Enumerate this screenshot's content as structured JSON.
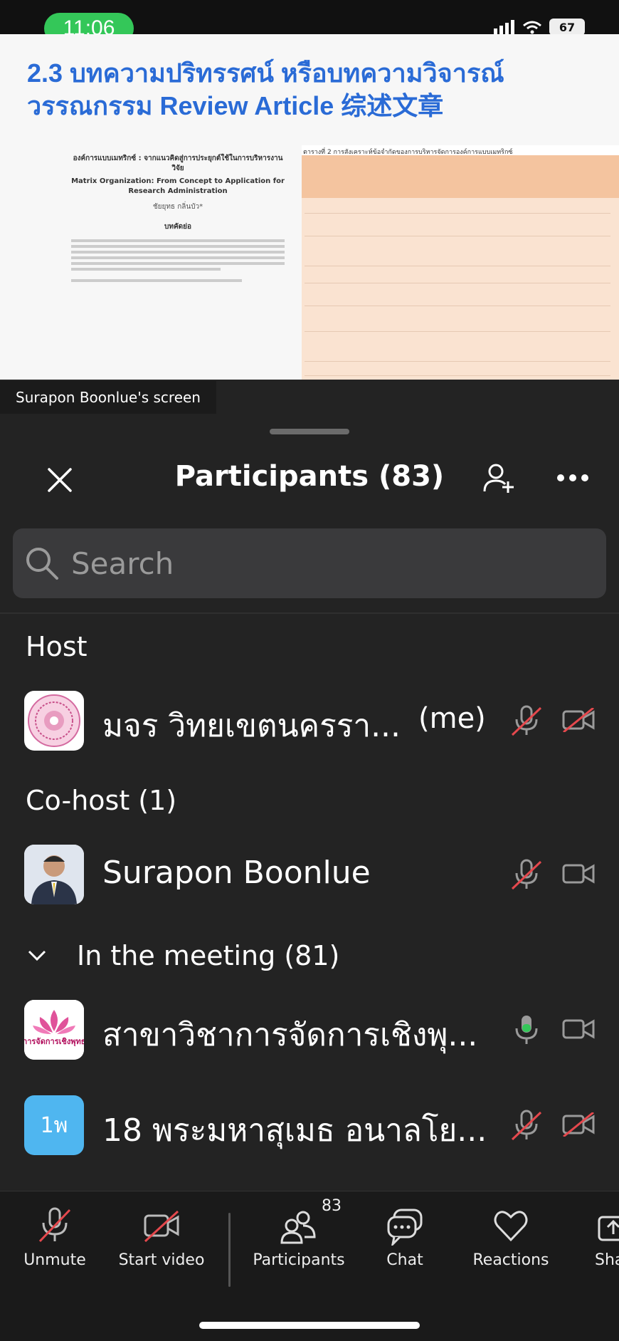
{
  "status_bar": {
    "time": "11:06",
    "battery": "67"
  },
  "shared_screen": {
    "slide_title_line1": "2.3 บทความปริทรรศน์ หรือบทความวิจารณ์",
    "slide_title_line2": "วรรณกรรม Review Article 综述文章",
    "paper_title_th": "องค์การแบบเมทริกซ์ : จากแนวคิดสู่การประยุกต์ใช้ในการบริหารงานวิจัย",
    "paper_title_en": "Matrix Organization: From Concept to Application for Research Administration",
    "paper_author": "ชัยยุทธ กลิ่นบัว*",
    "paper_abstract_heading": "บทคัดย่อ",
    "table_caption": "ตารางที่ 2 การสังเคราะห์ข้อจำกัดของการบริหารจัดการองค์การแบบเมทริกซ์",
    "presenter_label": "Surapon Boonlue's screen"
  },
  "participants_panel": {
    "title": "Participants (83)",
    "search_placeholder": "Search",
    "host_section": "Host",
    "cohost_section": "Co-host (1)",
    "meeting_section": "In the meeting (81)",
    "host": {
      "name": "มจร วิทยเขตนครรา...",
      "me_label": "(me)",
      "mic_muted": true,
      "video_off": true
    },
    "cohost": {
      "name": "Surapon Boonlue",
      "mic_muted": true,
      "video_off": false
    },
    "in_meeting": [
      {
        "name": "สาขาวิชาการจัดการเชิงพุ...",
        "mic_muted": false,
        "video_off": false,
        "avatar_text": "การจัดการเชิงพุทธ"
      },
      {
        "name": "18 พระมหาสุเมธ อนาลโย...",
        "mic_muted": true,
        "video_off": true,
        "avatar_text": "1พ"
      }
    ]
  },
  "toolbar": {
    "unmute": "Unmute",
    "start_video": "Start video",
    "participants": "Participants",
    "participants_count": "83",
    "chat": "Chat",
    "reactions": "Reactions",
    "share": "Sha"
  },
  "colors": {
    "accent_green": "#34c759",
    "slide_blue": "#2a6bd6",
    "muted_red": "#e5484d",
    "avatar_blue": "#4fb6f0"
  }
}
